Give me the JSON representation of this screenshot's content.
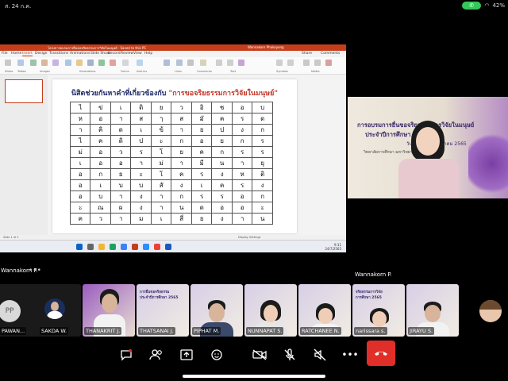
{
  "statusbar": {
    "time": "ส. 24 ก.ค.",
    "battery": "42%"
  },
  "powerpoint": {
    "title": "โครงการอบรมการยื่นขอจริยธรรมการวิจัยในมนุษย์ - Saved to this PC",
    "user": "Wannakorn Phakoyong",
    "tabs": [
      "File",
      "Home",
      "Insert",
      "Design",
      "Transitions",
      "Animations",
      "Slide Show",
      "Record",
      "Review",
      "View",
      "Help"
    ],
    "ribbon_groups": [
      "Slides",
      "Tables",
      "Images",
      "Illustrations",
      "Forms",
      "Add-ins",
      "Links",
      "Comments",
      "Text",
      "Symbols",
      "Media"
    ],
    "share_label": "Share",
    "comments_label": "Comments",
    "slide_title": "นิสิตช่วยกันหาคำที่เกี่ยวข้องกับ",
    "slide_title_highlight": "\"การขอจริยธรรมการวิจัยในมนุษย์\"",
    "grid": [
      [
        "ไ",
        "ข่",
        "เ",
        "ดิ",
        "ย",
        "ว",
        "อิ",
        "ช",
        "อ",
        "บ"
      ],
      [
        "ห",
        "อ",
        "า",
        "ส",
        "ๅ",
        "ส",
        "มั",
        "ค",
        "ร",
        "ด"
      ],
      [
        "า",
        "คิ",
        "ด",
        "เ",
        "ข้",
        "า",
        "ย",
        "ป",
        "ง",
        "ก"
      ],
      [
        "ไ",
        "ค",
        "ดิ",
        "ป",
        "ะ",
        "ก",
        "อ",
        "ย",
        "ก",
        "ร"
      ],
      [
        "ม่",
        "อ",
        "ว",
        "ร",
        "โ",
        "ย",
        "ค",
        "ก",
        "ร",
        "ร"
      ],
      [
        "เ",
        "อ",
        "อ",
        "า",
        "ม่",
        "า",
        "มี",
        "น",
        "า",
        "ยุ"
      ],
      [
        "อ",
        "ก",
        "ย",
        "ะ",
        "โ",
        "ค",
        "ร",
        "ง",
        "ห",
        "ติ"
      ],
      [
        "อ",
        "เ",
        "บ",
        "บ",
        "สั",
        "ง",
        "เ",
        "ค",
        "ร",
        "ง"
      ],
      [
        "อ",
        "บ",
        "า",
        "ง",
        "า",
        "ก",
        "ร",
        "ร",
        "อ",
        "ก"
      ],
      [
        "ะ",
        "ณ",
        "ผ",
        "ง",
        "า",
        "น",
        "ด",
        "อ",
        "อ",
        "ะ"
      ],
      [
        "ค",
        "ว",
        "า",
        "ม",
        "เ",
        "สี่",
        "ย",
        "ง",
        "า",
        "น"
      ]
    ],
    "status_left": "Slide 1 of 1",
    "status_right": "Display Settings",
    "clock_time": "9:11",
    "clock_date": "24/7/2565"
  },
  "speaker": {
    "name": "Wannakorn P.",
    "banner_line1": "การอบรมการยื่นขอจริยธรรมการวิจัยในมนุษย์",
    "banner_line2": "ประจำปีการศึกษา 2565",
    "banner_line3": "วันที่ 23-24 กรกฎาคม 2565",
    "banner_line4": "วิทยาลัยการศึกษา มหาวิทยาลัยพะเยา"
  },
  "share_label_name": "Wannakorn P.",
  "participants": [
    {
      "name": "PAWAN...",
      "initials": "PP"
    },
    {
      "name": "SAKDA W."
    },
    {
      "name": "THANAKRIT J."
    },
    {
      "name": "THATSANAI J."
    },
    {
      "name": "PIPHAT M."
    },
    {
      "name": "NUNNAPAT S."
    },
    {
      "name": "RATCHANEE N."
    },
    {
      "name": "narissara s."
    },
    {
      "name": "JIRAYU S."
    }
  ],
  "tile_banner": "การยื่นขอจริยธรรมการวิจัย\nประจำปีการศึกษา 2565",
  "controls": [
    "chat",
    "participants",
    "share",
    "reactions",
    "camera-off",
    "mic-off",
    "speaker-off",
    "more",
    "end-call"
  ],
  "colors": {
    "end_call": "#e02f28",
    "ppt_red": "#c43e1c",
    "call_pill": "#34c759"
  }
}
